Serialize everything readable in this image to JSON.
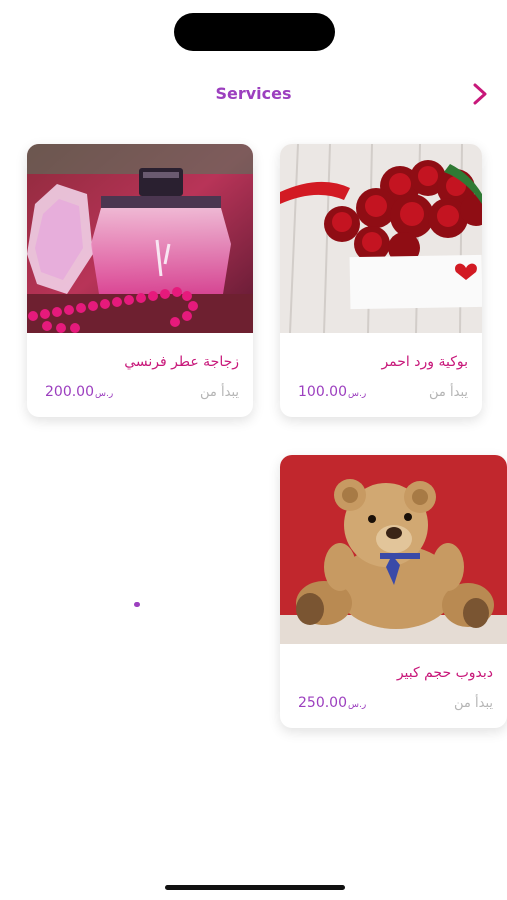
{
  "header": {
    "title": "Services",
    "back_icon": "chevron-right-icon",
    "accent_color": "#9c3fbf"
  },
  "products": [
    {
      "name": "بوكية ورد احمر",
      "from_label": "يبدأ من",
      "price": "100.00",
      "currency": "ر.س",
      "image": "red-roses-bouquet"
    },
    {
      "name": "زجاجة عطر فرنسي",
      "from_label": "يبدأ من",
      "price": "200.00",
      "currency": "ر.س",
      "image": "perfume-bottle"
    },
    {
      "name": "دبدوب حجم كبير",
      "from_label": "يبدأ من",
      "price": "250.00",
      "currency": "ر.س",
      "image": "teddy-bear"
    }
  ],
  "colors": {
    "product_name": "#c8187a",
    "price": "#9c3fbf",
    "from_label": "#b5b5b5"
  }
}
